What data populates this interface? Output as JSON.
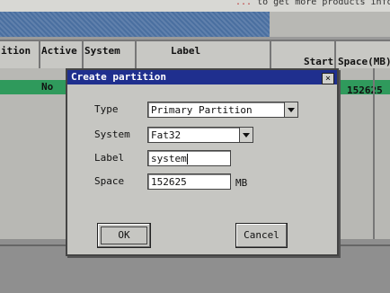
{
  "top": {
    "red_text": "...",
    "text": "to get more products informatio"
  },
  "table": {
    "columns": [
      "ition",
      "Active",
      "System",
      "Label",
      "Start",
      "Space(MB)"
    ],
    "selected_row": {
      "active": "No",
      "space": "152625"
    }
  },
  "dialog": {
    "title": "Create partition",
    "close_glyph": "×",
    "fields": {
      "type_label": "Type",
      "type_value": "Primary Partition",
      "system_label": "System",
      "system_value": "Fat32",
      "label_label": "Label",
      "label_value": "system",
      "space_label": "Space",
      "space_value": "152625",
      "space_unit": "MB"
    },
    "ok_label": "OK",
    "cancel_label": "Cancel"
  },
  "colors": {
    "titlebar": "#1f2f8e",
    "selected_row": "#2f9a5c",
    "header_hatch": "#4a6fa0"
  }
}
